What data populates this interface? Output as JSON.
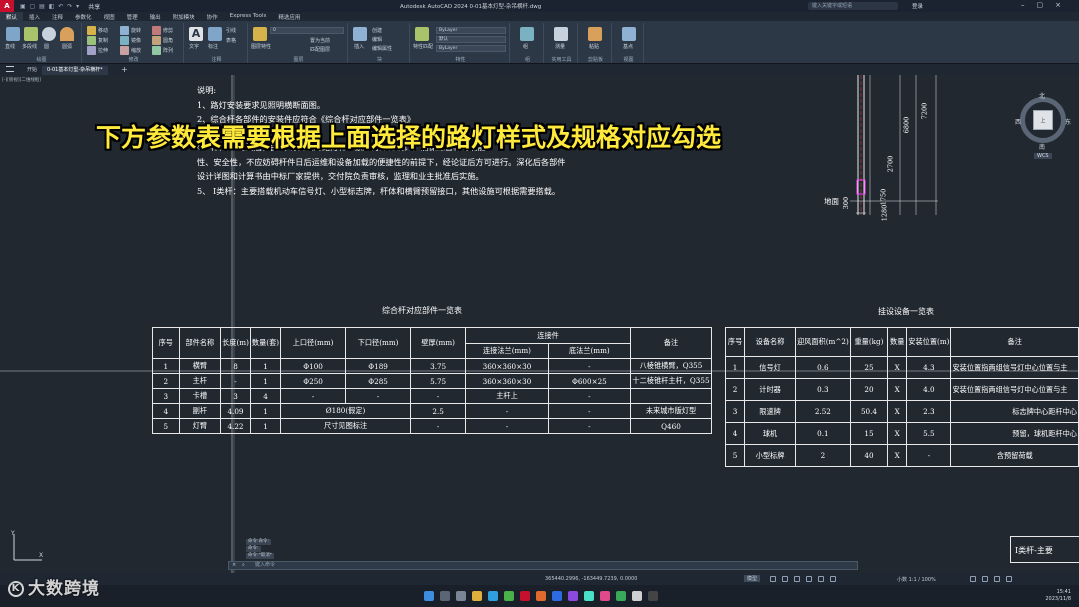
{
  "titlebar": {
    "logo": "A",
    "share": "共享",
    "title": "Autodesk AutoCAD 2024    0-01基本灯型-杂吊横杆.dwg",
    "search_placeholder": "键入关键字或短语",
    "user": "登录"
  },
  "ribbon_tabs": [
    "默认",
    "插入",
    "注释",
    "参数化",
    "视图",
    "管理",
    "输出",
    "附加模块",
    "协作",
    "Express Tools",
    "精选应用"
  ],
  "ribbon": {
    "groups": [
      {
        "label": "绘图",
        "tools": [
          "直线",
          "多段线",
          "圆",
          "圆弧"
        ]
      },
      {
        "label": "修改",
        "tools": [
          "移动",
          "旋转",
          "修剪",
          "复制",
          "镜像",
          "圆角",
          "拉伸",
          "缩放",
          "阵列"
        ]
      },
      {
        "label": "注释",
        "tools": [
          "文字",
          "标注",
          "引线",
          "表格"
        ]
      },
      {
        "label": "图层",
        "tools": [
          "图层特性",
          "置为当前",
          "匹配图层"
        ]
      },
      {
        "label": "块",
        "tools": [
          "插入",
          "创建",
          "编辑",
          "编辑属性"
        ]
      },
      {
        "label": "特性",
        "tools": [
          "特性匹配",
          "ByLayer",
          "默认",
          "ByLayer"
        ]
      },
      {
        "label": "组",
        "tools": [
          "组"
        ]
      },
      {
        "label": "实用工具",
        "tools": [
          "测量"
        ]
      },
      {
        "label": "剪贴板",
        "tools": [
          "粘贴"
        ]
      },
      {
        "label": "视图",
        "tools": [
          "基点"
        ]
      }
    ],
    "layer_value": "0",
    "color_value": "ByLayer",
    "linetype_value": "默认",
    "lineweight_value": "ByLayer"
  },
  "file_tabs": [
    "开始",
    "0-01基本灯型-杂吊横杆*"
  ],
  "viewport_label": "[-][俯视][二维线框]",
  "caption": "下方参数表需要根据上面选择的路灯样式及规格对应勾选",
  "notes": [
    "说明:",
    "1、路灯安装要求见照明横断面图。",
    "2、综合杆各部件的安装件应符合《综合杆对应部件一览表》",
    "3、",
    "4、杆件应    时间后，由大    有资质的路灯杆厂家进行深化设计，确保综合杆的功能",
    "性、安全性，不应妨碍杆件日后运维和设备加载的便捷性的前提下，经论证后方可进行。深化后各部件",
    "设计详图和计算书由中标厂家提供，交付院负责审核，监理和业主批准后实施。",
    "5、 I类杆：主要搭载机动车信号灯、小型标志牌，杆体和横臂预留接口，其他设施可根据需要搭载。"
  ],
  "table1": {
    "title": "综合杆对应部件一览表",
    "headers": [
      "序号",
      "部件名称",
      "长度(m)",
      "数量(套)",
      "上口径(mm)",
      "下口径(mm)",
      "壁厚(mm)",
      "连接件",
      "备注"
    ],
    "sub_headers": [
      "连接法兰(mm)",
      "底法兰(mm)"
    ],
    "rows": [
      [
        "1",
        "横臂",
        "8",
        "1",
        "Φ100",
        "Φ189",
        "3.75",
        "360×360×30",
        "-",
        "八棱锥横臂，Q355"
      ],
      [
        "2",
        "主杆",
        "-",
        "1",
        "Φ250",
        "Φ285",
        "5.75",
        "360×360×30",
        "Φ600×25",
        "十二棱锥杆主杆，Q355"
      ],
      [
        "3",
        "卡槽",
        "3",
        "4",
        "-",
        "-",
        "-",
        "主杆上",
        "-",
        ""
      ],
      [
        "4",
        "副杆",
        "4.09",
        "1",
        "Ø180(假定)",
        "2.5",
        "-",
        "-",
        "未来城市版灯型"
      ],
      [
        "5",
        "灯臂",
        "4.22",
        "1",
        "尺寸见图标注",
        "-",
        "-",
        "-",
        "Q460"
      ]
    ]
  },
  "table2": {
    "title": "挂设设备一览表",
    "headers": [
      "序号",
      "设备名称",
      "迎风面积(m^2)",
      "重量(kg)",
      "数量",
      "安装位置(m)",
      "备注"
    ],
    "rows": [
      [
        "1",
        "信号灯",
        "0.6",
        "25",
        "X",
        "4.3",
        "安装位置指两组信号灯中心位置与主"
      ],
      [
        "2",
        "计时器",
        "0.3",
        "20",
        "X",
        "4.0",
        "安装位置指两组信号灯中心位置与主"
      ],
      [
        "3",
        "限速牌",
        "2.52",
        "50.4",
        "X",
        "2.3",
        "标志牌中心距杆中心"
      ],
      [
        "4",
        "球机",
        "0.1",
        "15",
        "X",
        "5.5",
        "预留，球机距杆中心"
      ],
      [
        "5",
        "小型标牌",
        "2",
        "40",
        "X",
        "-",
        "含预留荷载"
      ]
    ]
  },
  "pole": {
    "dims": [
      "7200",
      "6800",
      "2700",
      "1750",
      "1280",
      "300"
    ],
    "ground_label": "地面"
  },
  "viewcube": {
    "north": "北",
    "south": "南",
    "west": "西",
    "east": "东",
    "face": "上",
    "wcs": "WCS"
  },
  "cut_box_text": "I类杆-主要",
  "command": {
    "history": [
      "命令:命令:",
      "命令:",
      "命令:*取消*"
    ],
    "placeholder": "键入命令",
    "close": "×",
    "key": "⌕"
  },
  "status": {
    "coords": "365440.2996, -163449.7239, 0.0000",
    "mode": "模型",
    "scale": "小数    1:1 / 100%"
  },
  "taskbar": {
    "time": "15:41",
    "date": "2023/11/8"
  },
  "watermark": "大数跨境",
  "colors": {
    "bg": "#212830",
    "caption": "#ffe93a",
    "ribbon": "#2c3846",
    "line": "#e8e8e8",
    "brand_red": "#c8102e"
  }
}
